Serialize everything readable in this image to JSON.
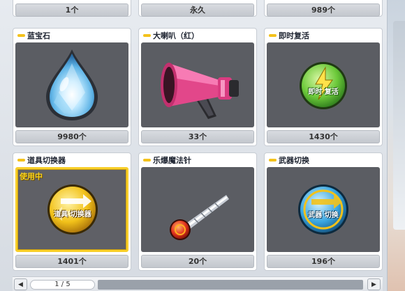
{
  "top_row": [
    {
      "count": "1个"
    },
    {
      "count": "永久"
    },
    {
      "count": "989个"
    }
  ],
  "items": [
    {
      "name": "蓝宝石",
      "count": "9980个",
      "icon": "sapphire-drop-icon",
      "in_use": false
    },
    {
      "name": "大喇叭（红）",
      "count": "33个",
      "icon": "red-megaphone-icon",
      "in_use": false
    },
    {
      "name": "即时复活",
      "count": "1430个",
      "icon": "instant-revive-badge-icon",
      "in_use": false,
      "badge_text": "即时 复活"
    },
    {
      "name": "道具切换器",
      "count": "1401个",
      "icon": "item-switcher-badge-icon",
      "in_use": true,
      "badge_text": "道具 切换器"
    },
    {
      "name": "乐爆魔法针",
      "count": "20个",
      "icon": "magic-needle-icon",
      "in_use": false
    },
    {
      "name": "武器切换",
      "count": "196个",
      "icon": "weapon-switch-badge-icon",
      "in_use": false,
      "badge_text": "武器 切换"
    }
  ],
  "in_use_label": "使用中",
  "pager": {
    "page": "1 / 5",
    "prev": "◀",
    "next": "▶"
  },
  "colors": {
    "accent_yellow": "#f8cf2a",
    "image_bg": "#5b5d63",
    "badge_green": "#6cc93a",
    "badge_gold": "#f2c21a",
    "badge_blue": "#3aa6e0"
  }
}
